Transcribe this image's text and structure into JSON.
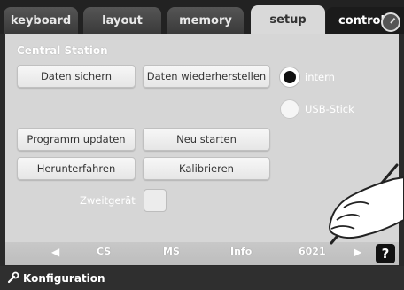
{
  "tabs": [
    {
      "label": "keyboard"
    },
    {
      "label": "layout"
    },
    {
      "label": "memory"
    },
    {
      "label": "setup"
    },
    {
      "label": "control"
    }
  ],
  "active_tab": "setup",
  "section_title": "Central Station",
  "buttons": {
    "backup": "Daten sichern",
    "restore": "Daten wiederherstellen",
    "update": "Programm updaten",
    "restart": "Neu starten",
    "shutdown": "Herunterfahren",
    "calibrate": "Kalibrieren"
  },
  "radio_options": [
    {
      "label": "intern",
      "selected": true
    },
    {
      "label": "USB-Stick",
      "selected": false
    }
  ],
  "checkbox": {
    "label": "Zweitgerät",
    "checked": false
  },
  "nav": {
    "items": [
      "CS",
      "MS",
      "Info",
      "6021"
    ],
    "help": "?"
  },
  "footer": {
    "title": "Konfiguration"
  },
  "colors": {
    "panel": "#d6d6d6",
    "tab_active": "#d9d9d9",
    "background": "#2a2a2a"
  }
}
